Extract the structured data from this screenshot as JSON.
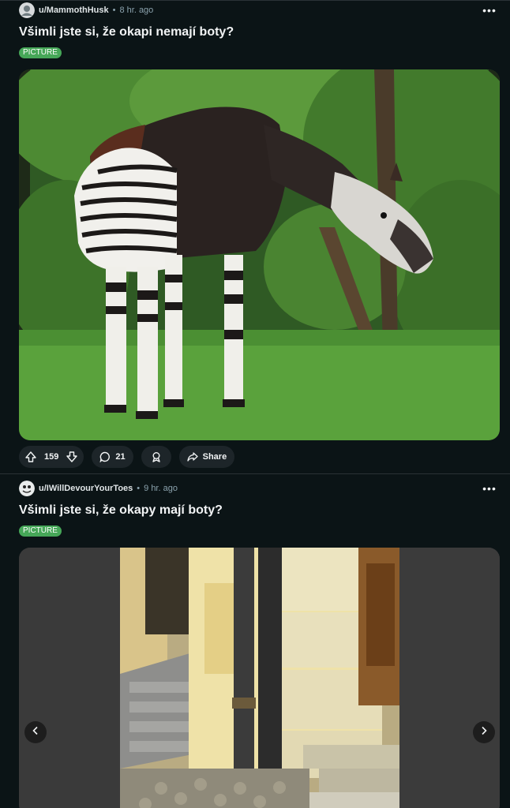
{
  "posts": [
    {
      "username": "u/MammothHusk",
      "time": "8 hr. ago",
      "title": "Všimli jste si, že okapi nemají boty?",
      "flair": "PICTURE",
      "image_icon": "okapi-photo",
      "score": "159",
      "comments": "21",
      "share_label": "Share"
    },
    {
      "username": "u/IWillDevourYourToes",
      "time": "9 hr. ago",
      "title": "Všimli jste si, že okapy mají boty?",
      "flair": "PICTURE",
      "image_icon": "drainpipe-photo"
    }
  ],
  "colors": {
    "background": "#0b1416",
    "flair": "#46a758",
    "pill": "#1d2529"
  }
}
